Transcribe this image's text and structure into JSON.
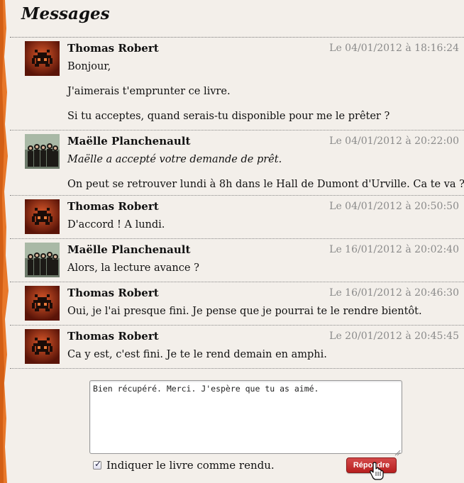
{
  "page": {
    "title": "Messages"
  },
  "colors": {
    "edge_orange": "#e8782a",
    "background": "#f3efea",
    "date_gray": "#8a8a8a",
    "button_red": "#c02828"
  },
  "messages": [
    {
      "author": "Thomas Robert",
      "date": "Le 04/01/2012 à 18:16:24",
      "avatar": "space-invader-avatar",
      "lines": [
        "Bonjour,",
        "J'aimerais t'emprunter ce livre.",
        "Si tu acceptes, quand serais-tu disponible pour me le prêter ?"
      ]
    },
    {
      "author": "Maëlle Planchenault",
      "date": "Le 04/01/2012 à 20:22:00",
      "avatar": "group-photo-avatar",
      "italic_line": "Maëlle a accepté votre demande de prêt.",
      "lines": [
        "On peut se retrouver lundi à 8h dans le Hall de Dumont d'Urville. Ca te va ?"
      ]
    },
    {
      "author": "Thomas Robert",
      "date": "Le 04/01/2012 à 20:50:50",
      "avatar": "space-invader-avatar",
      "lines": [
        "D'accord ! A lundi."
      ]
    },
    {
      "author": "Maëlle Planchenault",
      "date": "Le 16/01/2012 à 20:02:40",
      "avatar": "group-photo-avatar",
      "lines": [
        "Alors, la lecture avance ?"
      ]
    },
    {
      "author": "Thomas Robert",
      "date": "Le 16/01/2012 à 20:46:30",
      "avatar": "space-invader-avatar",
      "lines": [
        "Oui, je l'ai presque fini. Je pense que je pourrai te le rendre bientôt."
      ]
    },
    {
      "author": "Thomas Robert",
      "date": "Le 20/01/2012 à 20:45:45",
      "avatar": "space-invader-avatar",
      "lines": [
        "Ca y est, c'est fini. Je te le rend demain en amphi."
      ]
    }
  ],
  "reply": {
    "text": "Bien récupéré. Merci. J'espère que tu as aimé.",
    "checkbox_label": "Indiquer le livre comme rendu.",
    "checkbox_checked": true,
    "button_label": "Répondre"
  }
}
